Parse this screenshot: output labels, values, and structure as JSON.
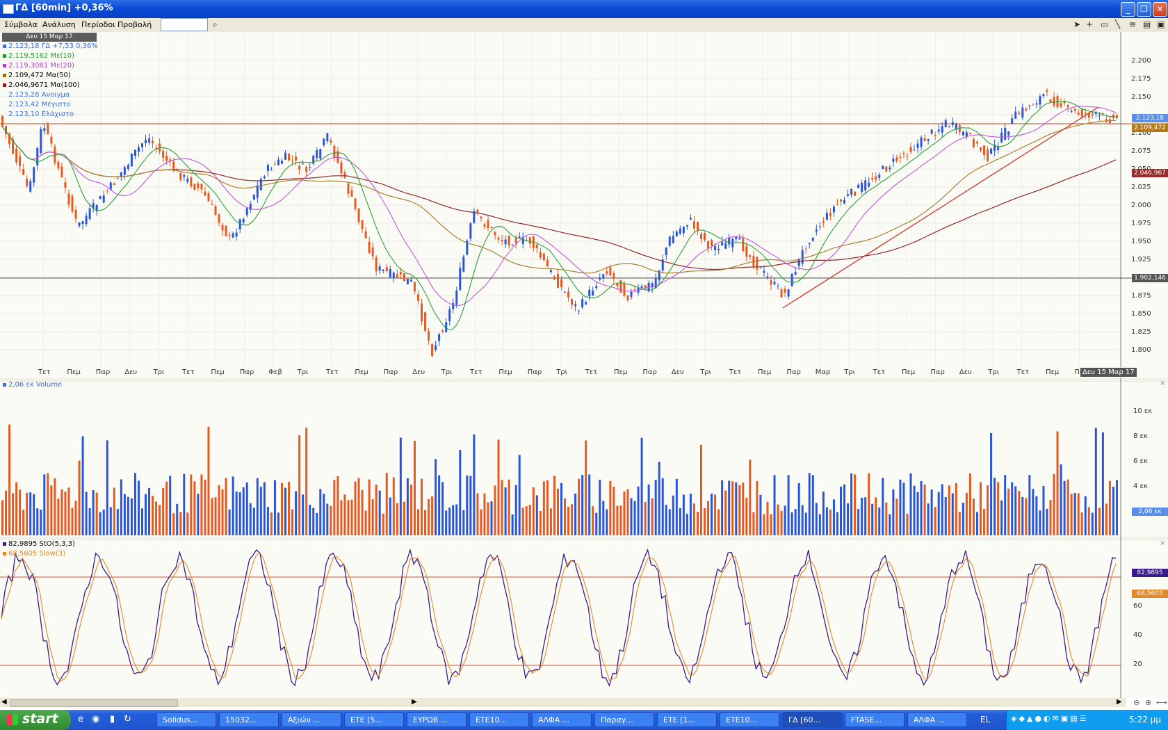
{
  "window": {
    "title": "ΓΔ [60min] +0,36%",
    "colors": {
      "titlebar": "#0a4bd6",
      "panel_bg": "#fbfbf6",
      "up": "#2a56d6",
      "down": "#e35a23"
    }
  },
  "menu": {
    "items": [
      "Σύμβολα",
      "Ανάλυση",
      "Περίοδοι",
      "Προβολή"
    ]
  },
  "toolbar": {
    "icons": [
      "cursor-icon",
      "crosshair-icon",
      "rectangle-icon",
      "line-icon",
      "grid-icon",
      "chart-icon",
      "save-icon"
    ]
  },
  "price_panel": {
    "date_badge": "Δευ 15 Μαρ 17",
    "legend": [
      {
        "text": "2.123,18 ΓΔ +7,53 0,36%",
        "color": "#3a6fd8"
      },
      {
        "text": "2.119,5162 Με(10)",
        "color": "#1e9a2a"
      },
      {
        "text": "2.119,3081 Με(20)",
        "color": "#b03ec9"
      },
      {
        "text": "2.109,472 Μα(50)",
        "color": "#9a6a10"
      },
      {
        "text": "2.046,9671 Μα(100)",
        "color": "#8b1a1a"
      },
      {
        "text": "2.123,28 Ανοιγμα",
        "color": "#3a6fd8"
      },
      {
        "text": "2.123,42 Μέγιστο",
        "color": "#3a6fd8"
      },
      {
        "text": "2.123,10 Ελάχιστο",
        "color": "#3a6fd8"
      }
    ],
    "y_ticks": [
      "2.200",
      "2.175",
      "2.150",
      "2.125",
      "2.100",
      "2.075",
      "2.050",
      "2.025",
      "2.000",
      "1.975",
      "1.950",
      "1.925",
      "1.900",
      "1.875",
      "1.850",
      "1.825",
      "1.800"
    ],
    "price_tags": [
      {
        "text": "2.123,18",
        "color": "#5b8ee8"
      },
      {
        "text": "2.109,472",
        "color": "#b5791a"
      },
      {
        "text": "2.046,967",
        "color": "#9b2a2a"
      },
      {
        "text": "1.902,146",
        "color": "#555555"
      }
    ],
    "date_ticks": [
      "Τετ",
      "Πεμ",
      "Παρ",
      "Δευ",
      "Τρι",
      "Τετ",
      "Πεμ",
      "Παρ",
      "Φεβ",
      "Τρι",
      "Τετ",
      "Πεμ",
      "Παρ",
      "Δευ",
      "Τρι",
      "Τετ",
      "Πεμ",
      "Παρ",
      "Τρι",
      "Τετ",
      "Πεμ",
      "Παρ",
      "Δευ",
      "Τρι",
      "Τετ",
      "Πεμ",
      "Παρ",
      "Μαρ",
      "Τρι",
      "Τετ",
      "Πεμ",
      "Παρ",
      "Δευ",
      "Τρι",
      "Τετ",
      "Πεμ",
      "Παρ"
    ],
    "date_tick_current": "Δευ 15 Μαρ 17"
  },
  "volume_panel": {
    "legend": "2,06 εκ Volume",
    "y_ticks": [
      "10 εκ",
      "8 εκ",
      "6 εκ",
      "4 εκ"
    ],
    "tag": "2,06 εκ"
  },
  "stoch_panel": {
    "legend": [
      {
        "text": "82,9895 StO(5,3,3)",
        "color": "#3a1a8a"
      },
      {
        "text": "68,5605 Slow(3)",
        "color": "#e08a2a"
      }
    ],
    "y_ticks": [
      "60",
      "40",
      "20"
    ],
    "tags": [
      {
        "text": "82,9895",
        "color": "#3a1a8a"
      },
      {
        "text": "68,5605",
        "color": "#e08a2a"
      }
    ]
  },
  "taskbar": {
    "start": "start",
    "tasks": [
      "Solidus...",
      "15032...",
      "Αξιών ...",
      "ΕΤΕ [5...",
      "ΕΥΡΩΒ ...",
      "ΕΤΕ10...",
      "ΑΛΦΑ ...",
      "Παραγ...",
      "ΕΤΕ [1...",
      "ΕΤΕ10...",
      "ΓΔ [60...",
      "FTASE...",
      "ΑΛΦΑ ..."
    ],
    "active_index": 10,
    "lang": "EL",
    "clock": "5:22 μμ"
  }
}
